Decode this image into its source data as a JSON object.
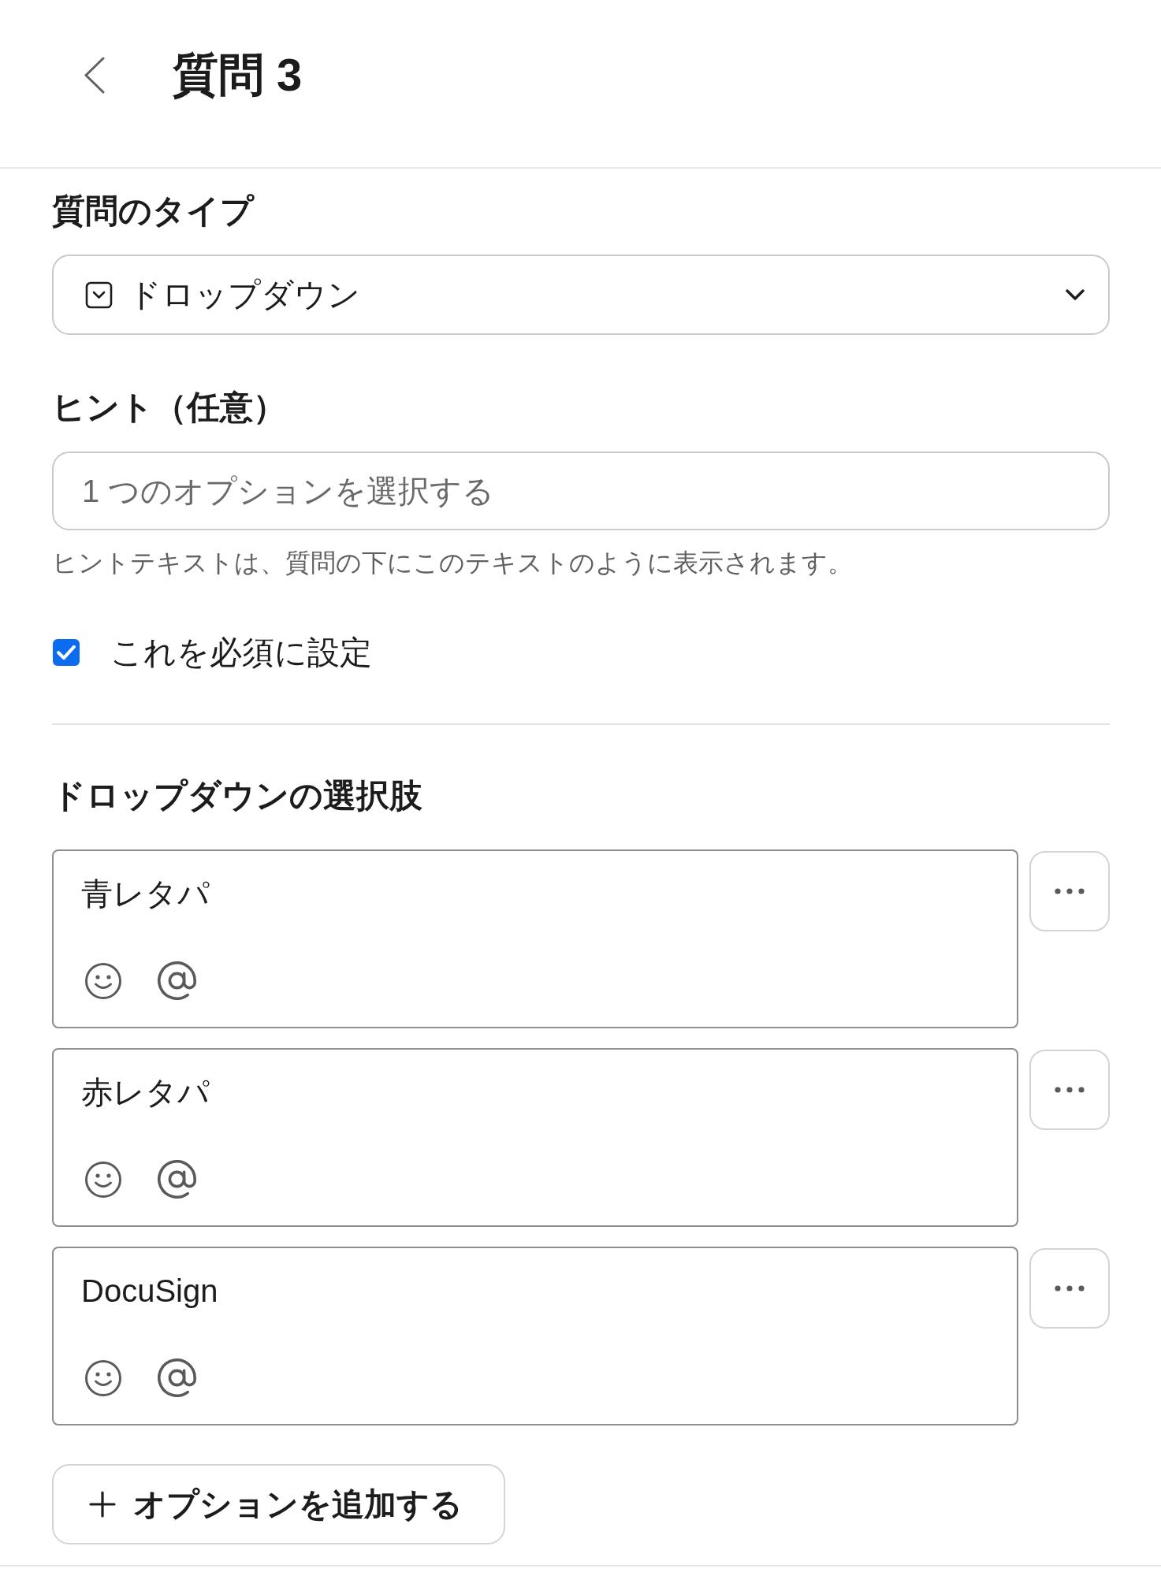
{
  "header": {
    "title": "質問 3"
  },
  "question_type": {
    "label": "質問のタイプ",
    "value": "ドロップダウン"
  },
  "hint": {
    "label": "ヒント（任意）",
    "placeholder": "1 つのオプションを選択する",
    "help_text": "ヒントテキストは、質問の下にこのテキストのように表示されます。"
  },
  "required": {
    "label": "これを必須に設定",
    "checked": true
  },
  "choices": {
    "heading": "ドロップダウンの選択肢",
    "options": [
      {
        "text": "青レタパ"
      },
      {
        "text": "赤レタパ"
      },
      {
        "text": "DocuSign"
      }
    ],
    "add_button": "オプションを追加する"
  }
}
